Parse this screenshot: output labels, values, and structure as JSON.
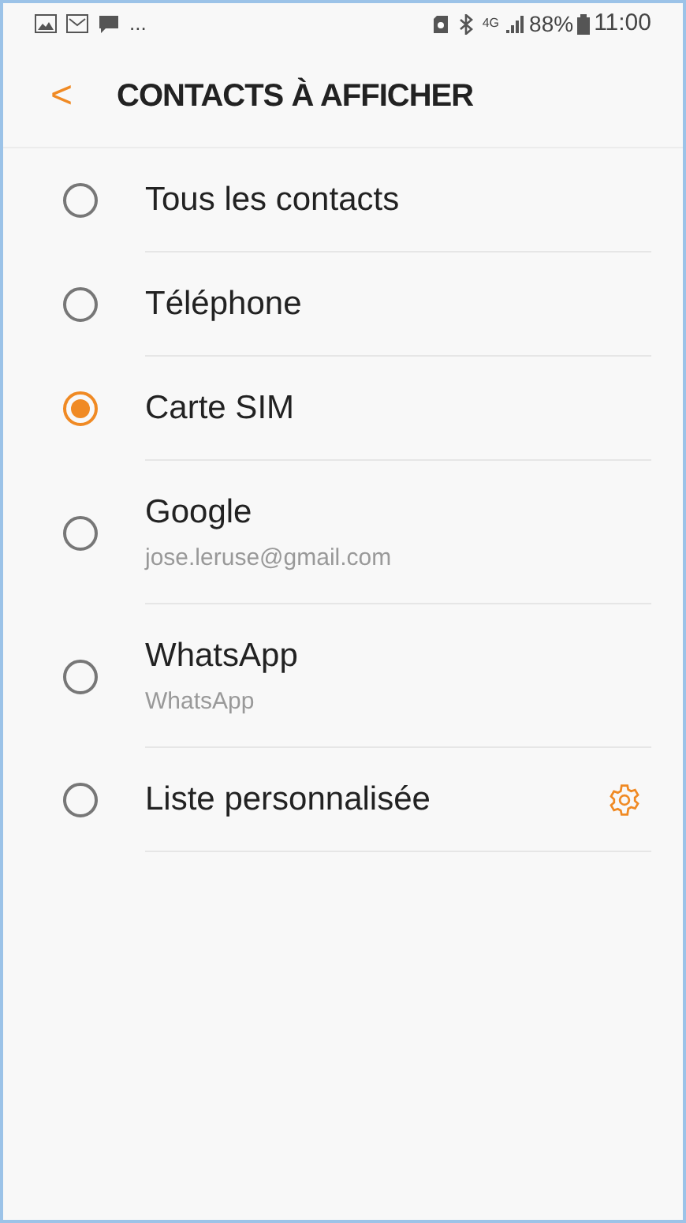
{
  "status_bar": {
    "more": "...",
    "network": "4G",
    "battery": "88%",
    "time": "11:00"
  },
  "header": {
    "back": "<",
    "title": "CONTACTS À AFFICHER"
  },
  "options": [
    {
      "label": "Tous les contacts",
      "selected": false,
      "settings": false
    },
    {
      "label": "Téléphone",
      "selected": false,
      "settings": false
    },
    {
      "label": "Carte SIM",
      "selected": true,
      "settings": false
    },
    {
      "label": "Google",
      "subtitle": "jose.leruse@gmail.com",
      "selected": false,
      "settings": false
    },
    {
      "label": "WhatsApp",
      "subtitle": "WhatsApp",
      "selected": false,
      "settings": false
    },
    {
      "label": "Liste personnalisée",
      "selected": false,
      "settings": true
    }
  ]
}
